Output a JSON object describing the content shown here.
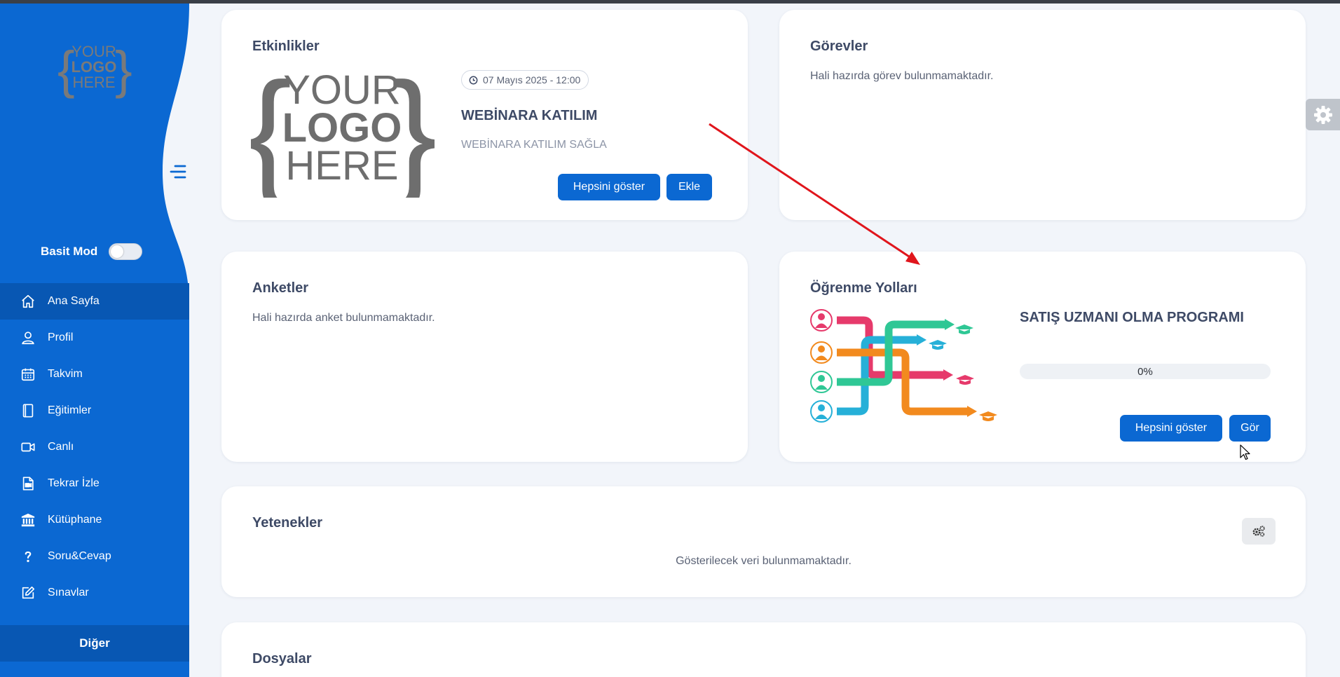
{
  "sidebar": {
    "logo_text": [
      "YOUR",
      "LOGO",
      "HERE"
    ],
    "basit_mod_label": "Basit Mod",
    "items": [
      {
        "label": "Ana Sayfa",
        "icon": "home-icon",
        "active": true
      },
      {
        "label": "Profil",
        "icon": "user-icon"
      },
      {
        "label": "Takvim",
        "icon": "calendar-icon"
      },
      {
        "label": "Eğitimler",
        "icon": "book-icon"
      },
      {
        "label": "Canlı",
        "icon": "video-camera-icon"
      },
      {
        "label": "Tekrar İzle",
        "icon": "video-file-icon"
      },
      {
        "label": "Kütüphane",
        "icon": "library-icon"
      },
      {
        "label": "Soru&Cevap",
        "icon": "question-icon"
      },
      {
        "label": "Sınavlar",
        "icon": "edit-icon"
      }
    ],
    "other_label": "Diğer"
  },
  "etkinlikler": {
    "title": "Etkinlikler",
    "logo_text": [
      "YOUR",
      "LOGO",
      "HERE"
    ],
    "date": "07 Mayıs 2025 - 12:00",
    "event_title": "WEBİNARA KATILIM",
    "event_subtitle": "WEBİNARA KATILIM SAĞLA",
    "show_all_label": "Hepsini göster",
    "add_label": "Ekle"
  },
  "gorevler": {
    "title": "Görevler",
    "empty_text": "Hali hazırda görev bulunmamaktadır."
  },
  "anketler": {
    "title": "Anketler",
    "empty_text": "Hali hazırda anket bulunmamaktadır."
  },
  "ogrenme_yollari": {
    "title": "Öğrenme Yolları",
    "program_title": "SATIŞ UZMANI OLMA PROGRAMI",
    "progress_text": "0%",
    "progress_value": 0,
    "show_all_label": "Hepsini göster",
    "view_label": "Gör"
  },
  "yetenekler": {
    "title": "Yetenekler",
    "empty_text": "Gösterilecek veri bulunmamaktadır."
  },
  "dosyalar": {
    "title": "Dosyalar"
  },
  "colors": {
    "primary": "#0b68d2",
    "primary_dark": "#0857b3",
    "background": "#f2f5fa",
    "annotation_arrow": "#e0151c"
  }
}
